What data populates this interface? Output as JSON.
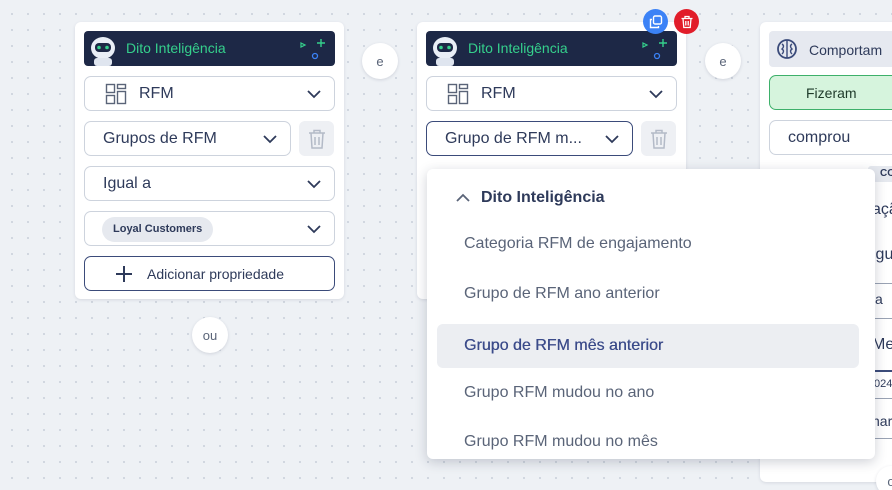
{
  "colors": {
    "header_bg": "#1d2846",
    "brand_green": "#35d08c",
    "accent_navy": "#3b4b7a",
    "copy_button": "#3b82f6",
    "delete_button": "#e11d2a",
    "did_green_bg": "#d6f4dd"
  },
  "card1": {
    "header_title": "Dito Inteligência",
    "field_source": "RFM",
    "field_property": "Grupos de RFM",
    "field_operator": "Igual a",
    "value_chip": "Loyal Customers",
    "add_property": "Adicionar propriedade"
  },
  "card2": {
    "header_title": "Dito Inteligência",
    "field_source": "RFM",
    "field_property": "Grupo de RFM m..."
  },
  "connectors": {
    "and_1": "e",
    "and_2": "e",
    "or": "ou"
  },
  "card3": {
    "header_title": "Comportam",
    "did_toggle": "Fizeram",
    "event_field": "comprou",
    "peek_tag": "CO",
    "peek_lines": [
      "açã",
      "igu",
      "a",
      "Me",
      "024",
      "nar"
    ],
    "peek_bottom": "o"
  },
  "dropdown": {
    "group_label": "Dito Inteligência",
    "items": [
      "Categoria RFM de engajamento",
      "Grupo de RFM ano anterior",
      "Grupo de RFM mês anterior",
      "Grupo RFM mudou no ano",
      "Grupo RFM mudou no mês"
    ],
    "selected_index": 2
  }
}
